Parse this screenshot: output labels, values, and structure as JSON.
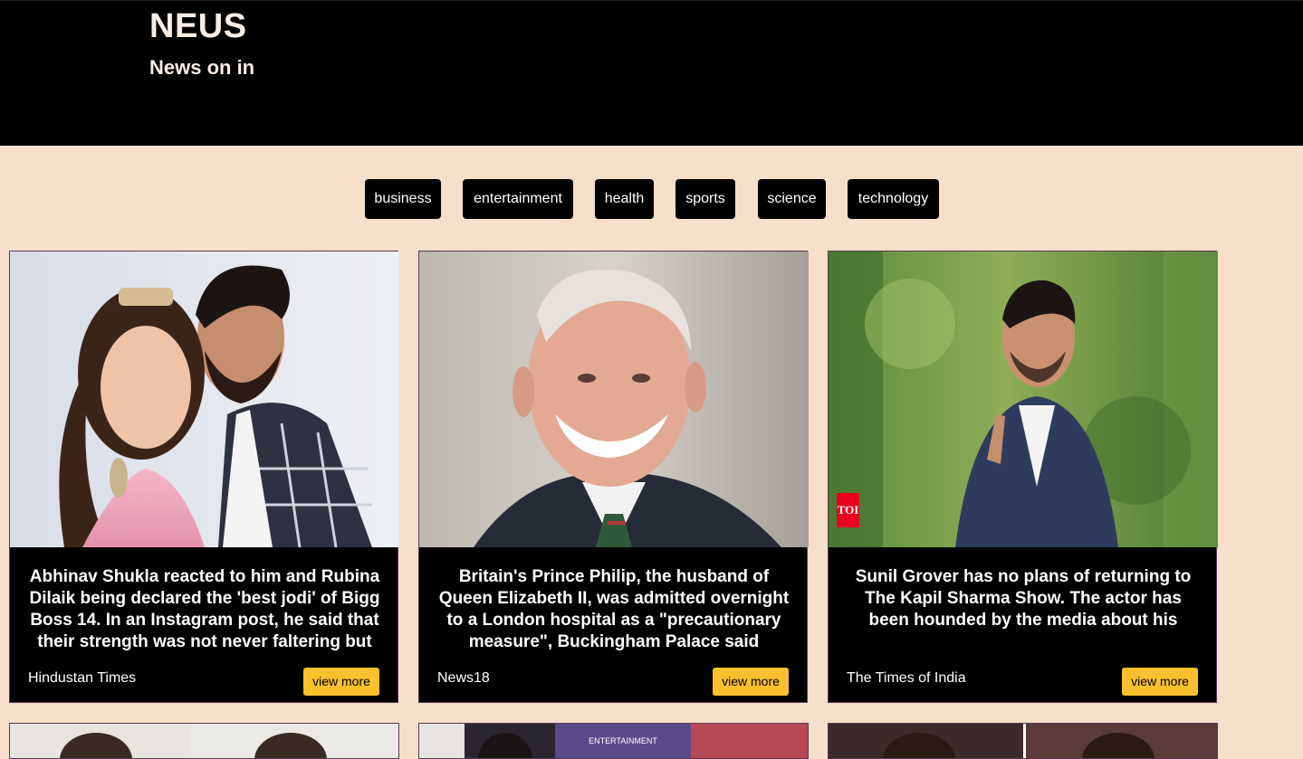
{
  "header": {
    "brand": "NEUS",
    "tagline": "News on in"
  },
  "categories": [
    "business",
    "entertainment",
    "health",
    "sports",
    "science",
    "technology"
  ],
  "cards": [
    {
      "headline": "Abhinav Shukla reacted to him and Rubina Dilaik being declared the 'best jodi' of Bigg Boss 14. In an Instagram post, he said that their strength was not never faltering but",
      "source": "Hindustan Times",
      "button": "view more"
    },
    {
      "headline": "Britain's Prince Philip, the husband of Queen Elizabeth II, was admitted overnight to a London hospital as a \"precautionary measure\", Buckingham Palace said",
      "source": "News18",
      "button": "view more"
    },
    {
      "headline": "Sunil Grover has no plans of returning to The Kapil Sharma Show. The actor has been hounded by the media about his",
      "source": "The Times of India",
      "button": "view more",
      "watermark": "TOI"
    }
  ],
  "second_row": {
    "card2_sign": "ENTERTAINMENT"
  }
}
